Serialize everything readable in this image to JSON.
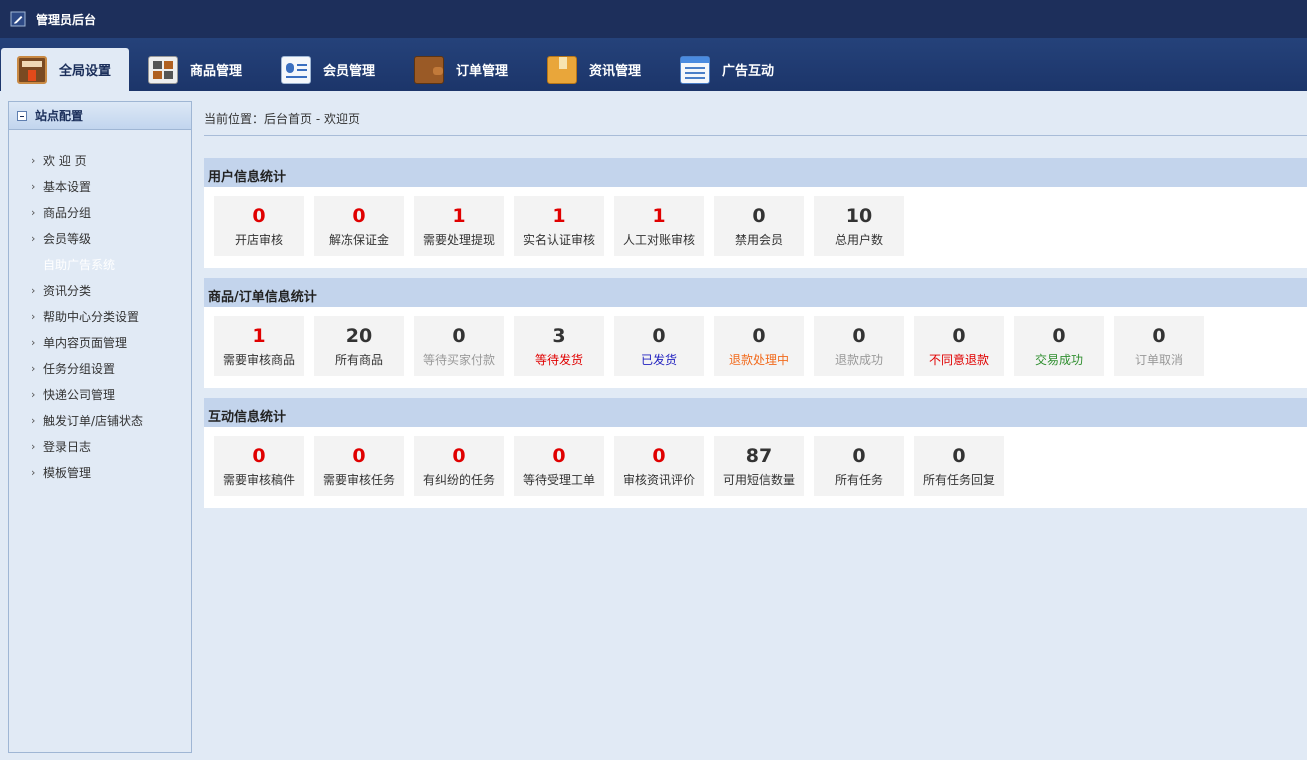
{
  "app": {
    "title": "管理员后台"
  },
  "nav": {
    "tabs": [
      {
        "label": "全局设置",
        "icon": "window-icon",
        "active": true
      },
      {
        "label": "商品管理",
        "icon": "grid-icon",
        "active": false
      },
      {
        "label": "会员管理",
        "icon": "member-card-icon",
        "active": false
      },
      {
        "label": "订单管理",
        "icon": "wallet-icon",
        "active": false
      },
      {
        "label": "资讯管理",
        "icon": "folder-icon",
        "active": false
      },
      {
        "label": "广告互动",
        "icon": "list-window-icon",
        "active": false
      }
    ]
  },
  "sidebar": {
    "header": "站点配置",
    "items": [
      {
        "label": "欢 迎 页"
      },
      {
        "label": "基本设置"
      },
      {
        "label": "商品分组"
      },
      {
        "label": "会员等级"
      },
      {
        "label": "自助广告系统"
      },
      {
        "label": "资讯分类"
      },
      {
        "label": "帮助中心分类设置"
      },
      {
        "label": "单内容页面管理"
      },
      {
        "label": "任务分组设置"
      },
      {
        "label": "快递公司管理"
      },
      {
        "label": "触发订单/店铺状态"
      },
      {
        "label": "登录日志"
      },
      {
        "label": "模板管理"
      }
    ]
  },
  "breadcrumb": "当前位置：后台首页 - 欢迎页",
  "colors": {
    "red": "#e00000",
    "dark": "#333333",
    "gray": "#999999",
    "blue": "#1f1fbf",
    "orange": "#f26b1d",
    "green": "#2f8f2f"
  },
  "sections": [
    {
      "title": "用户信息统计",
      "cards": [
        {
          "value": "0",
          "label": "开店审核",
          "num_color": "red",
          "label_color": "dark"
        },
        {
          "value": "0",
          "label": "解冻保证金",
          "num_color": "red",
          "label_color": "dark"
        },
        {
          "value": "1",
          "label": "需要处理提现",
          "num_color": "red",
          "label_color": "dark"
        },
        {
          "value": "1",
          "label": "实名认证审核",
          "num_color": "red",
          "label_color": "dark"
        },
        {
          "value": "1",
          "label": "人工对账审核",
          "num_color": "red",
          "label_color": "dark"
        },
        {
          "value": "0",
          "label": "禁用会员",
          "num_color": "dark",
          "label_color": "dark"
        },
        {
          "value": "10",
          "label": "总用户数",
          "num_color": "dark",
          "label_color": "dark"
        }
      ]
    },
    {
      "title": "商品/订单信息统计",
      "cards": [
        {
          "value": "1",
          "label": "需要审核商品",
          "num_color": "red",
          "label_color": "dark"
        },
        {
          "value": "20",
          "label": "所有商品",
          "num_color": "dark",
          "label_color": "dark"
        },
        {
          "value": "0",
          "label": "等待买家付款",
          "num_color": "dark",
          "label_color": "gray"
        },
        {
          "value": "3",
          "label": "等待发货",
          "num_color": "dark",
          "label_color": "red"
        },
        {
          "value": "0",
          "label": "已发货",
          "num_color": "dark",
          "label_color": "blue"
        },
        {
          "value": "0",
          "label": "退款处理中",
          "num_color": "dark",
          "label_color": "orange"
        },
        {
          "value": "0",
          "label": "退款成功",
          "num_color": "dark",
          "label_color": "gray"
        },
        {
          "value": "0",
          "label": "不同意退款",
          "num_color": "dark",
          "label_color": "red"
        },
        {
          "value": "0",
          "label": "交易成功",
          "num_color": "dark",
          "label_color": "green"
        },
        {
          "value": "0",
          "label": "订单取消",
          "num_color": "dark",
          "label_color": "gray"
        }
      ]
    },
    {
      "title": "互动信息统计",
      "cards": [
        {
          "value": "0",
          "label": "需要审核稿件",
          "num_color": "red",
          "label_color": "dark"
        },
        {
          "value": "0",
          "label": "需要审核任务",
          "num_color": "red",
          "label_color": "dark"
        },
        {
          "value": "0",
          "label": "有纠纷的任务",
          "num_color": "red",
          "label_color": "dark"
        },
        {
          "value": "0",
          "label": "等待受理工单",
          "num_color": "red",
          "label_color": "dark"
        },
        {
          "value": "0",
          "label": "审核资讯评价",
          "num_color": "red",
          "label_color": "dark"
        },
        {
          "value": "87",
          "label": "可用短信数量",
          "num_color": "dark",
          "label_color": "dark"
        },
        {
          "value": "0",
          "label": "所有任务",
          "num_color": "dark",
          "label_color": "dark"
        },
        {
          "value": "0",
          "label": "所有任务回复",
          "num_color": "dark",
          "label_color": "dark"
        }
      ]
    }
  ]
}
